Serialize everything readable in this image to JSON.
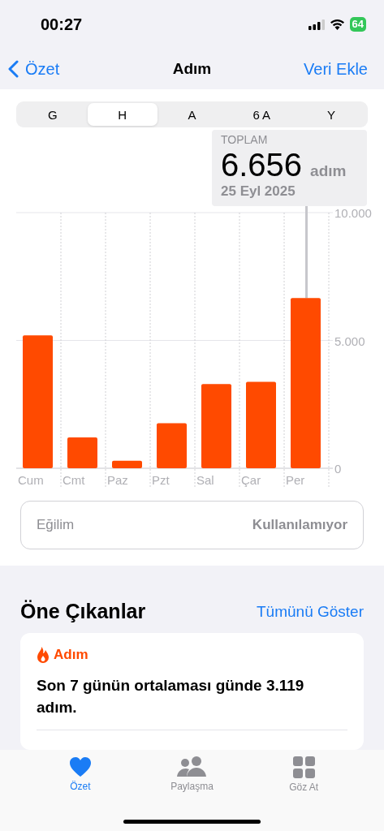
{
  "status_bar": {
    "time": "00:27",
    "battery": "64"
  },
  "nav": {
    "back": "Özet",
    "title": "Adım",
    "action": "Veri Ekle"
  },
  "segments": [
    {
      "label": "G",
      "selected": false
    },
    {
      "label": "H",
      "selected": true
    },
    {
      "label": "A",
      "selected": false
    },
    {
      "label": "6 A",
      "selected": false
    },
    {
      "label": "Y",
      "selected": false
    }
  ],
  "summary": {
    "label": "TOPLAM",
    "value": "6.656",
    "unit": "adım",
    "date": "25 Eyl 2025"
  },
  "chart_data": {
    "type": "bar",
    "categories": [
      "Cum",
      "Cmt",
      "Paz",
      "Pzt",
      "Sal",
      "Çar",
      "Per"
    ],
    "values": [
      5200,
      1210,
      290,
      1760,
      3290,
      3380,
      6656
    ],
    "ylim": [
      0,
      10000
    ],
    "yticks": [
      {
        "value": 0,
        "label": "0"
      },
      {
        "value": 5000,
        "label": "5.000"
      },
      {
        "value": 10000,
        "label": "10.000"
      }
    ]
  },
  "trend": {
    "label": "Eğilim",
    "value": "Kullanılamıyor"
  },
  "highlights": {
    "title": "Öne Çıkanlar",
    "action": "Tümünü Göster",
    "card": {
      "category": "Adım",
      "text": "Son 7 günün ortalaması günde 3.119 adım."
    }
  },
  "tab_bar": [
    {
      "label": "Özet",
      "kind": "heart",
      "selected": true
    },
    {
      "label": "Paylaşma",
      "kind": "people",
      "selected": false
    },
    {
      "label": "Göz At",
      "kind": "grid",
      "selected": false
    }
  ]
}
